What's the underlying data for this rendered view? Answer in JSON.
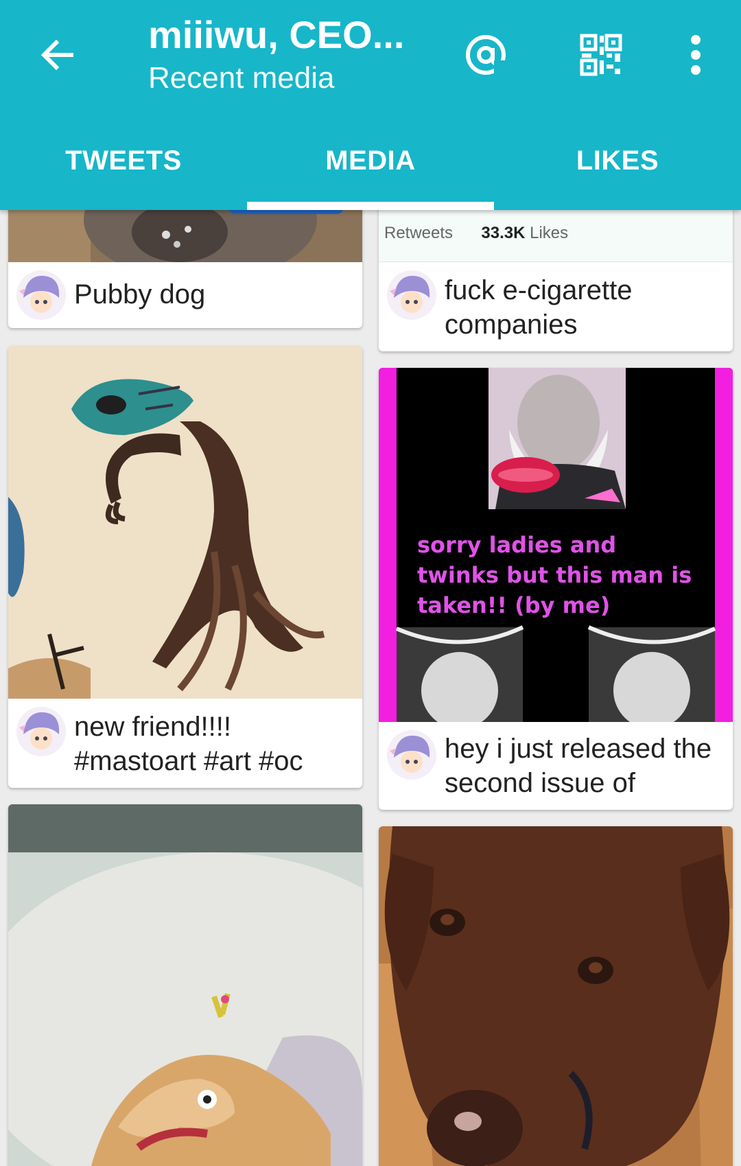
{
  "appbar": {
    "title": "miiiwu, CEO...",
    "subtitle": "Recent media",
    "background_color": "#17b6c9"
  },
  "tabs": [
    {
      "label": "TWEETS"
    },
    {
      "label": "MEDIA"
    },
    {
      "label": "LIKES"
    }
  ],
  "active_tab": "MEDIA",
  "icons": {
    "back": "arrow-left-icon",
    "mention": "at-sign-icon",
    "qr": "qr-code-icon",
    "overflow": "more-vert-icon"
  },
  "cards": {
    "pubby_dog": {
      "caption": "Pubby dog"
    },
    "ecig": {
      "retweets_label": "Retweets",
      "likes_value": "33.3K",
      "likes_label": "Likes",
      "caption": "fuck e-cigarette companies"
    },
    "new_friend": {
      "caption": "new friend!!!! #mastoart #art #oc"
    },
    "marx": {
      "image_text": "sorry ladies and twinks but this man is taken!! (by me)",
      "caption": "hey i just released the second issue of"
    },
    "lizard": {
      "caption": ""
    },
    "brown_dog": {
      "caption": ""
    }
  }
}
